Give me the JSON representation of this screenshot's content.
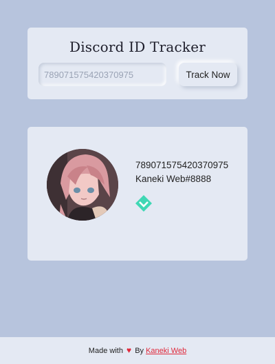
{
  "header": {
    "title": "Discord ID Tracker"
  },
  "search": {
    "value": "789071575420370975",
    "button_label": "Track Now"
  },
  "profile": {
    "user_id": "789071575420370975",
    "username": "Kaneki Web#8888",
    "avatar_icon": "anime-avatar-icon",
    "badge_icon": "hypesquad-balance-badge-icon",
    "badge_color": "#3fd7b4"
  },
  "footer": {
    "made_with": "Made with",
    "heart": "♥",
    "by": "By",
    "author_link": "Kaneki Web"
  },
  "colors": {
    "background": "#b7c4dd",
    "card": "#e4e9f3",
    "accent_red": "#e0283a"
  }
}
